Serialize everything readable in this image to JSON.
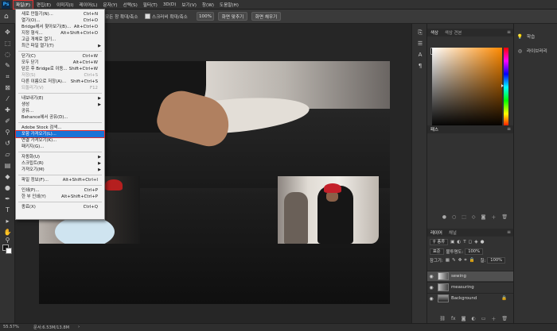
{
  "app": {
    "logo": "Ps",
    "menus": [
      "파일(F)",
      "편집(E)",
      "이미지(I)",
      "레이어(L)",
      "문자(Y)",
      "선택(S)",
      "필터(T)",
      "3D(D)",
      "보기(V)",
      "창(W)",
      "도움말(H)"
    ]
  },
  "options": {
    "fit_all_windows": "모든 창 확대/축소",
    "scrubby_zoom": "스크러비 확대/축소",
    "zoom_value": "100%",
    "fit_screen": "화면 맞추기",
    "fill_screen": "화면 채우기"
  },
  "file_menu": {
    "items": [
      {
        "label": "새로 만들기(N)...",
        "shortcut": "Ctrl+N"
      },
      {
        "label": "열기(O)...",
        "shortcut": "Ctrl+O"
      },
      {
        "label": "Bridge에서 찾아보기(B)...",
        "shortcut": "Alt+Ctrl+O"
      },
      {
        "label": "지정 형식...",
        "shortcut": "Alt+Shift+Ctrl+O"
      },
      {
        "label": "고급 개체로 열기...",
        "shortcut": ""
      },
      {
        "label": "최근 파일 열기(T)",
        "shortcut": ""
      },
      {
        "label": "닫기(C)",
        "shortcut": "Ctrl+W"
      },
      {
        "label": "모두 닫기",
        "shortcut": "Alt+Ctrl+W"
      },
      {
        "label": "닫은 후 Bridge로 이동...",
        "shortcut": "Shift+Ctrl+W"
      },
      {
        "label": "저장(S)",
        "shortcut": "Ctrl+S"
      },
      {
        "label": "다른 이름으로 저장(A)...",
        "shortcut": "Shift+Ctrl+S"
      },
      {
        "label": "되돌리기(V)",
        "shortcut": "F12"
      },
      {
        "label": "내보내기(E)",
        "shortcut": ""
      },
      {
        "label": "생성",
        "shortcut": ""
      },
      {
        "label": "공유...",
        "shortcut": ""
      },
      {
        "label": "Behance에서 공유(D)...",
        "shortcut": ""
      },
      {
        "label": "Adobe Stock 검색...",
        "shortcut": ""
      },
      {
        "label": "포함 가져오기(L)...",
        "shortcut": ""
      },
      {
        "label": "연결 가져오기(K)...",
        "shortcut": ""
      },
      {
        "label": "패키지(G)...",
        "shortcut": ""
      },
      {
        "label": "자동화(U)",
        "shortcut": ""
      },
      {
        "label": "스크립트(R)",
        "shortcut": ""
      },
      {
        "label": "가져오기(M)",
        "shortcut": ""
      },
      {
        "label": "파일 정보(F)...",
        "shortcut": "Alt+Shift+Ctrl+I"
      },
      {
        "label": "인쇄(P)...",
        "shortcut": "Ctrl+P"
      },
      {
        "label": "한 부 인쇄(Y)",
        "shortcut": "Alt+Shift+Ctrl+P"
      },
      {
        "label": "종료(X)",
        "shortcut": "Ctrl+Q"
      }
    ]
  },
  "status": {
    "zoom": "55.57%",
    "doc_size": "문서:6.53M/13.8M"
  },
  "panels": {
    "color_tabs": [
      "색상",
      "색상 견본"
    ],
    "props_tab": "패스",
    "layers_tabs": [
      "레이어",
      "채널"
    ],
    "kind_filter": "종류",
    "blend_mode": "표준",
    "opacity_label": "불투명도:",
    "opacity_value": "100%",
    "lock_label": "잠그기:",
    "fill_label": "칠:",
    "fill_value": "100%",
    "layers": [
      {
        "name": "sewing",
        "selected": true
      },
      {
        "name": "measuring",
        "selected": false
      },
      {
        "name": "Background",
        "selected": false
      }
    ]
  },
  "mini_panel": {
    "learn": "학습",
    "libraries": "라이브러리"
  }
}
